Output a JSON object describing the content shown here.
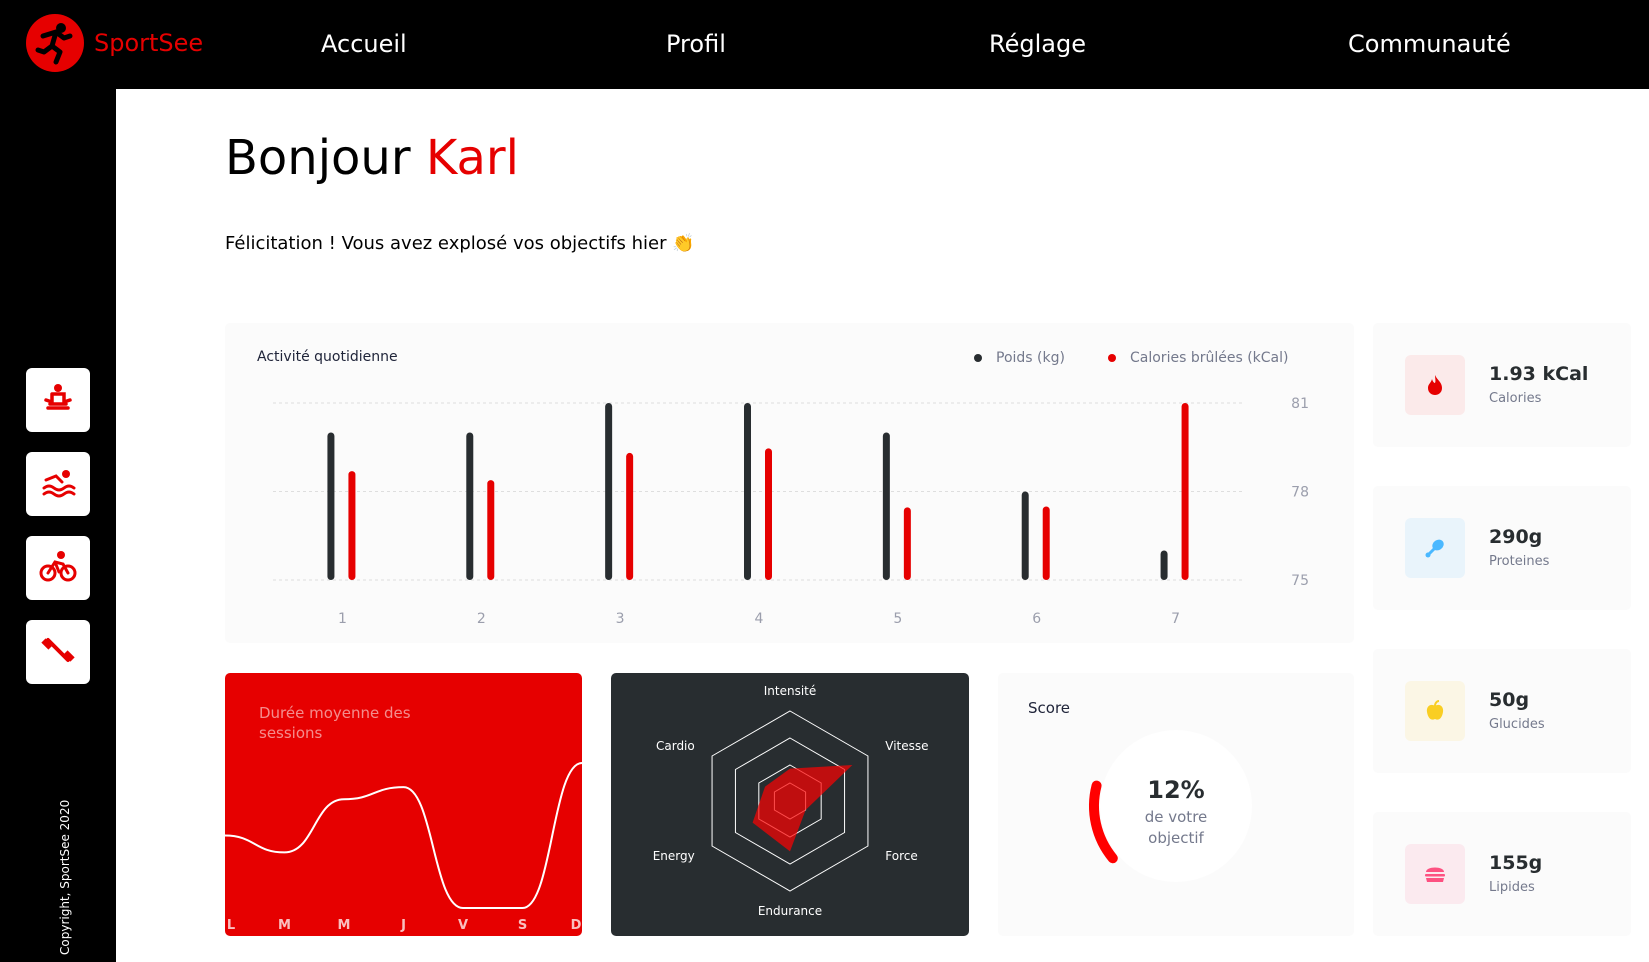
{
  "app": {
    "name": "SportSee"
  },
  "nav": [
    {
      "label": "Accueil"
    },
    {
      "label": "Profil"
    },
    {
      "label": "Réglage"
    },
    {
      "label": "Communauté"
    }
  ],
  "sidebar": {
    "items": [
      {
        "icon": "meditation-icon"
      },
      {
        "icon": "swimming-icon"
      },
      {
        "icon": "cycling-icon"
      },
      {
        "icon": "dumbbell-icon"
      }
    ],
    "copyright": "Copyright, SportSee 2020"
  },
  "header": {
    "greeting": "Bonjour",
    "name": "Karl",
    "message": "Félicitation ! Vous avez explosé vos objectifs hier 👏"
  },
  "activity": {
    "title": "Activité quotidienne",
    "legend_weight": "Poids (kg)",
    "legend_calories": "Calories brûlées (kCal)"
  },
  "duration": {
    "title": "Durée moyenne des sessions"
  },
  "score": {
    "title": "Score",
    "value": "12%",
    "line1": "de votre",
    "line2": "objectif",
    "fraction": 0.12
  },
  "key_data": [
    {
      "value": "1.93 kCal",
      "label": "Calories",
      "icon": "fire-icon",
      "bg": "#fbeaea",
      "color": "#e60000"
    },
    {
      "value": "290g",
      "label": "Proteines",
      "icon": "chicken-icon",
      "bg": "#e9f4fb",
      "color": "#4ab8ff"
    },
    {
      "value": "50g",
      "label": "Glucides",
      "icon": "apple-icon",
      "bg": "#fbf6e5",
      "color": "#f9ce23"
    },
    {
      "value": "155g",
      "label": "Lipides",
      "icon": "burger-icon",
      "bg": "#fbeaef",
      "color": "#fd5181"
    }
  ],
  "colors": {
    "accent": "#e60000",
    "dark": "#282d30",
    "weight_bar": "#282d30",
    "calorie_bar": "#e60000"
  },
  "chart_data": [
    {
      "type": "bar",
      "categories": [
        "1",
        "2",
        "3",
        "4",
        "5",
        "6",
        "7"
      ],
      "series": [
        {
          "name": "Poids (kg)",
          "values": [
            80,
            80,
            81,
            81,
            80,
            78,
            76
          ]
        },
        {
          "name": "Calories brûlées (kCal)",
          "values": [
            240,
            220,
            280,
            290,
            160,
            162,
            390
          ]
        }
      ],
      "y_ticks": [
        "75",
        "78",
        "81"
      ],
      "ylim": [
        75,
        81
      ]
    },
    {
      "type": "line",
      "categories": [
        "L",
        "M",
        "M",
        "J",
        "V",
        "S",
        "D"
      ],
      "values": [
        30,
        23,
        45,
        50,
        0,
        0,
        60
      ]
    },
    {
      "type": "radar",
      "categories": [
        "Intensité",
        "Vitesse",
        "Force",
        "Endurance",
        "Energy",
        "Cardio"
      ],
      "values": [
        90,
        200,
        50,
        140,
        120,
        80
      ],
      "max": 250
    }
  ]
}
